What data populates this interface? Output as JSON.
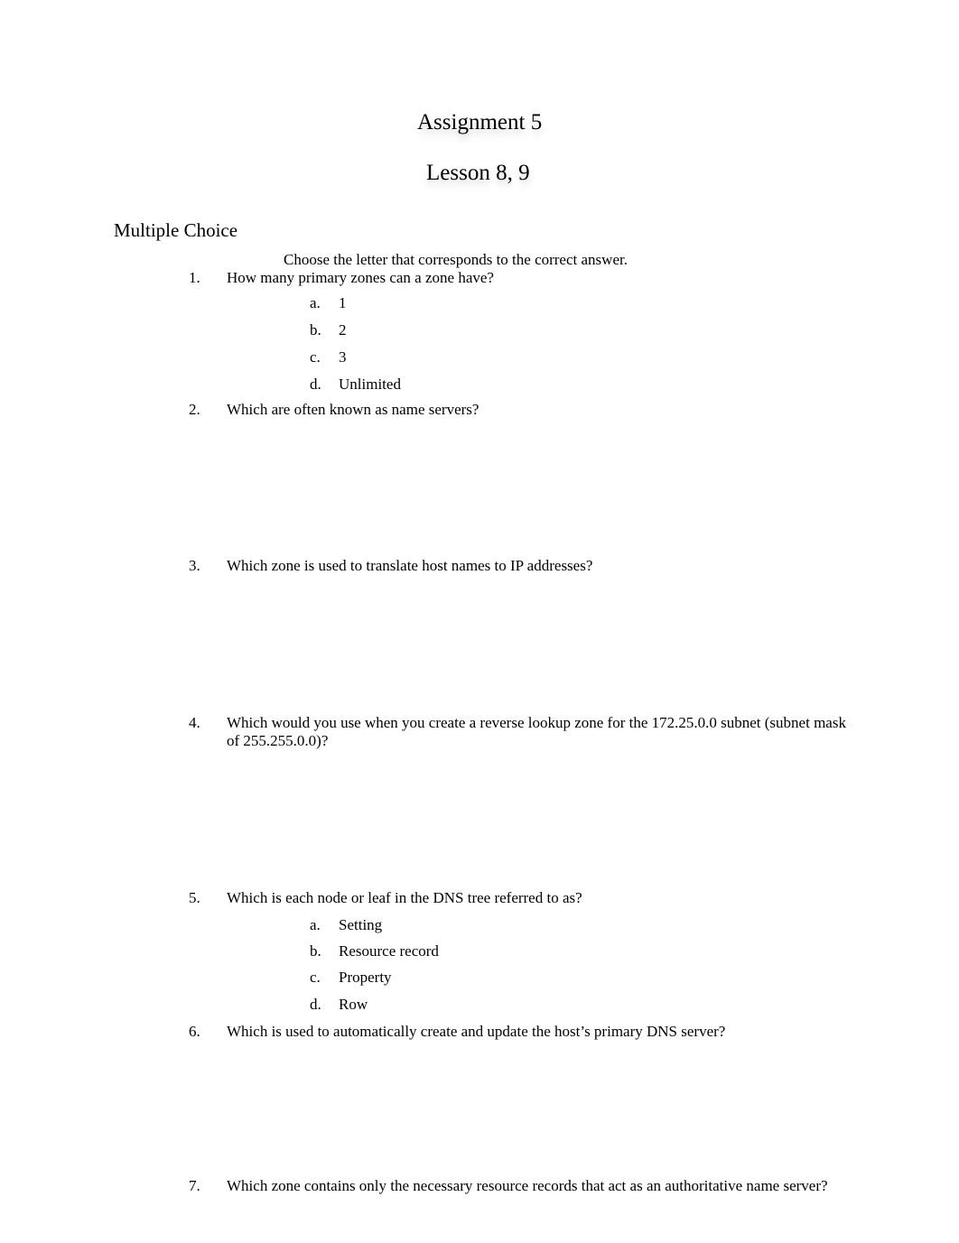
{
  "document": {
    "title": "Assignment 5",
    "subtitle": "Lesson 8, 9",
    "section_heading": "Multiple Choice",
    "instructions": "Choose the letter that corresponds to the correct answer."
  },
  "questions": [
    {
      "number": "1.",
      "text": "How many primary zones can a zone have?",
      "options": [
        {
          "letter": "a.",
          "text": "1"
        },
        {
          "letter": "b.",
          "text": "2"
        },
        {
          "letter": "c.",
          "text": "3"
        },
        {
          "letter": "d.",
          "text": "Unlimited"
        }
      ]
    },
    {
      "number": "2.",
      "text": "Which are often known as name servers?",
      "options": []
    },
    {
      "number": "3.",
      "text": "Which zone is used to translate host names to IP addresses?",
      "options": []
    },
    {
      "number": "4.",
      "text": "Which would you use when you create a reverse lookup zone for the 172.25.0.0 subnet (subnet mask of 255.255.0.0)?",
      "options": []
    },
    {
      "number": "5.",
      "text": "Which is each node or leaf in the DNS tree referred to as?",
      "options": [
        {
          "letter": "a.",
          "text": "Setting"
        },
        {
          "letter": "b.",
          "text": "Resource record"
        },
        {
          "letter": "c.",
          "text": "Property"
        },
        {
          "letter": "d.",
          "text": "Row"
        }
      ]
    },
    {
      "number": "6.",
      "text": "Which is used to automatically create and update the host’s primary DNS server?",
      "options": []
    },
    {
      "number": "7.",
      "text": "Which zone contains only the necessary resource records that act as an authoritative name server?",
      "options": []
    }
  ]
}
